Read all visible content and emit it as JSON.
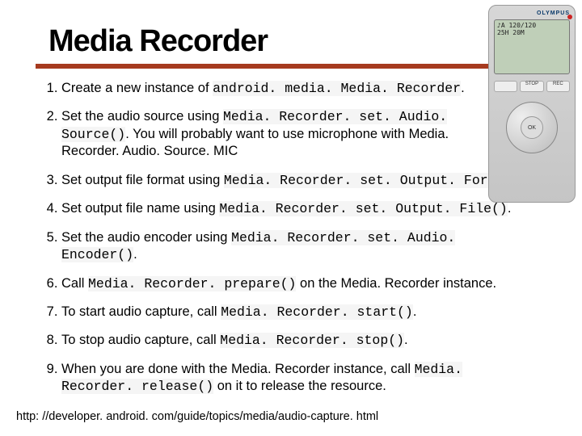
{
  "title": "Media Recorder",
  "steps": [
    {
      "pre": "Create a new instance of ",
      "code": "android. media. Media. Recorder",
      "post": "."
    },
    {
      "pre": "Set the audio source using ",
      "code": "Media. Recorder. set. Audio. Source()",
      "post": ". You will probably want to use microphone with Media. Recorder. Audio. Source. MIC"
    },
    {
      "pre": "Set output file format using ",
      "code": "Media. Recorder. set. Output. Format()",
      "post": "."
    },
    {
      "pre": "Set output file name using ",
      "code": "Media. Recorder. set. Output. File()",
      "post": "."
    },
    {
      "pre": "Set the audio encoder using ",
      "code": "Media. Recorder. set. Audio. Encoder()",
      "post": "."
    },
    {
      "pre": "Call ",
      "code": "Media. Recorder. prepare()",
      "post": " on the Media. Recorder instance."
    },
    {
      "pre": "To start audio capture, call ",
      "code": "Media. Recorder. start()",
      "post": "."
    },
    {
      "pre": "To stop audio capture, call ",
      "code": "Media. Recorder. stop()",
      "post": "."
    },
    {
      "pre": "When you are done with the Media. Recorder instance, call ",
      "code": "Media. Recorder. release()",
      "post": " on it to release the resource."
    }
  ],
  "footer": "http: //developer. android. com/guide/topics/media/audio-capture. html",
  "device": {
    "brand": "OLYMPUS",
    "screen_top": "♪A 120/120",
    "screen_mid": "25H 20M",
    "btn_stop": "STOP",
    "btn_rec": "REC",
    "wheel": "OK"
  }
}
